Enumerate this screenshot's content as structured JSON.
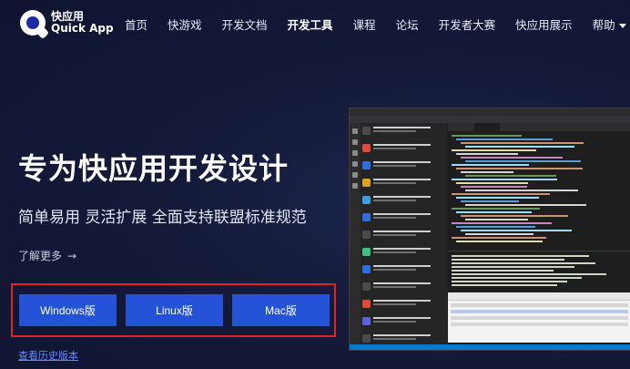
{
  "brand": {
    "name_cn": "快应用",
    "name_en": "Quick App"
  },
  "nav": {
    "items": [
      {
        "label": "首页"
      },
      {
        "label": "快游戏"
      },
      {
        "label": "开发文档"
      },
      {
        "label": "开发工具",
        "active": true
      },
      {
        "label": "课程"
      },
      {
        "label": "论坛"
      },
      {
        "label": "开发者大赛"
      },
      {
        "label": "快应用展示"
      },
      {
        "label": "帮助"
      }
    ]
  },
  "hero": {
    "title": "专为快应用开发设计",
    "subtitle": "简单易用 灵活扩展 全面支持联盟标准规范",
    "learn_more": "了解更多",
    "learn_more_arrow": "→"
  },
  "downloads": {
    "windows": "Windows版",
    "linux": "Linux版",
    "mac": "Mac版",
    "history": "查看历史版本"
  },
  "colors": {
    "background": "#141a38",
    "button": "#2453d8",
    "highlight_border": "#e02424",
    "link": "#5f8bff"
  },
  "icons": {
    "logo": "quick-app-logo",
    "dropdown": "chevron-down-icon"
  }
}
